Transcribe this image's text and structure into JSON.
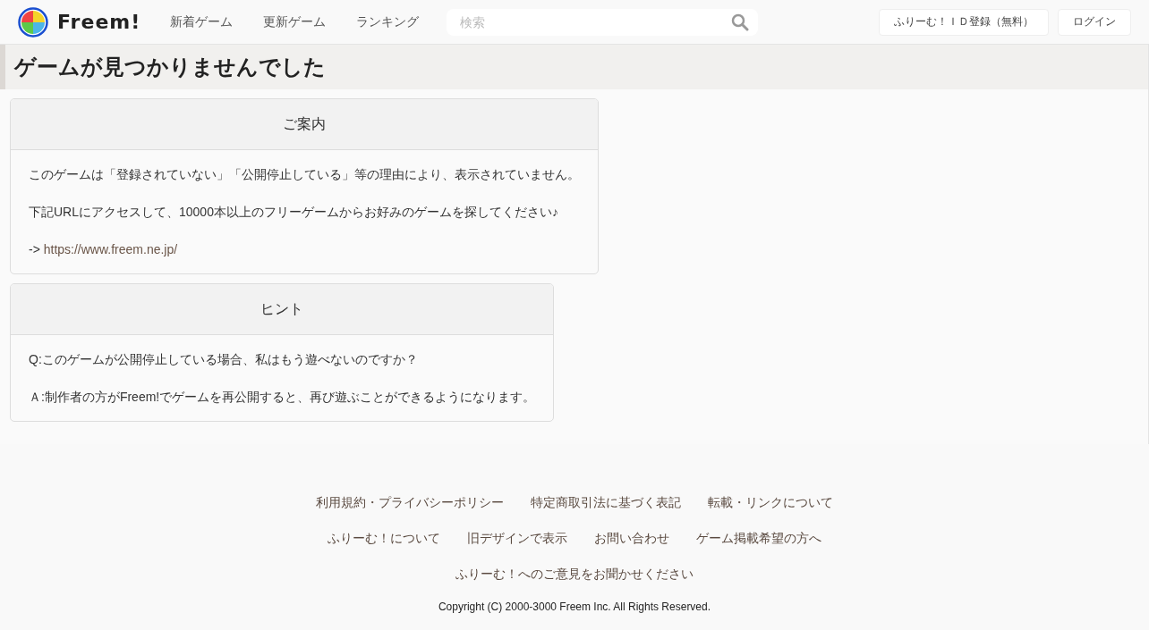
{
  "header": {
    "logo_text": "Freem!",
    "nav": [
      "新着ゲーム",
      "更新ゲーム",
      "ランキング"
    ],
    "search": {
      "placeholder": "検索"
    },
    "buttons": [
      "ふりーむ！ＩＤ登録（無料）",
      "ログイン"
    ]
  },
  "page_title": "ゲームが見つかりませんでした",
  "cards": [
    {
      "title": "ご案内",
      "paragraphs": [
        {
          "text": "このゲームは「登録されていない」「公開停止している」等の理由により、表示されていません。"
        },
        {
          "text": "下記URLにアクセスして、10000本以上のフリーゲームからお好みのゲームを探してください♪"
        },
        {
          "text": "-> ",
          "link": "https://www.freem.ne.jp/"
        }
      ]
    },
    {
      "title": "ヒント",
      "paragraphs": [
        {
          "text": "Q:このゲームが公開停止している場合、私はもう遊べないのですか？"
        },
        {
          "text": "Ａ:制作者の方がFreem!でゲームを再公開すると、再び遊ぶことができるようになります。"
        }
      ]
    }
  ],
  "footer": {
    "link_rows": [
      [
        "利用規約・プライバシーポリシー",
        "特定商取引法に基づく表記",
        "転載・リンクについて"
      ],
      [
        "ふりーむ！について",
        "旧デザインで表示",
        "お問い合わせ",
        "ゲーム掲載希望の方へ"
      ],
      [
        "ふりーむ！へのご意見をお聞かせください"
      ]
    ],
    "copyright": "Copyright (C) 2000-3000 Freem Inc. All Rights Reserved."
  }
}
